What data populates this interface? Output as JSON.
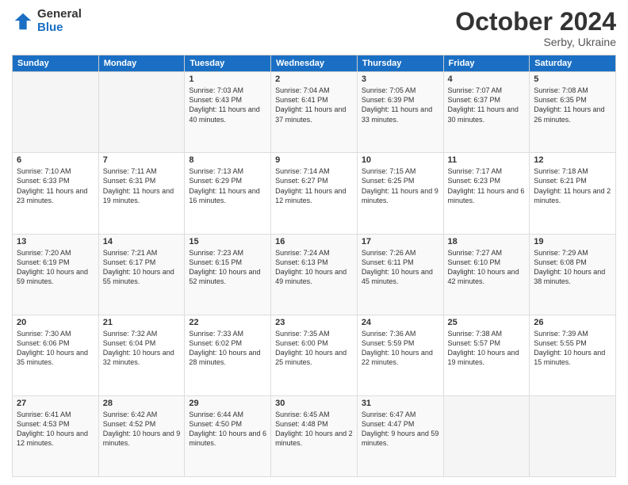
{
  "logo": {
    "general": "General",
    "blue": "Blue"
  },
  "header": {
    "month_year": "October 2024",
    "location": "Serby, Ukraine"
  },
  "weekdays": [
    "Sunday",
    "Monday",
    "Tuesday",
    "Wednesday",
    "Thursday",
    "Friday",
    "Saturday"
  ],
  "weeks": [
    [
      {
        "day": "",
        "content": ""
      },
      {
        "day": "",
        "content": ""
      },
      {
        "day": "1",
        "content": "Sunrise: 7:03 AM\nSunset: 6:43 PM\nDaylight: 11 hours and 40 minutes."
      },
      {
        "day": "2",
        "content": "Sunrise: 7:04 AM\nSunset: 6:41 PM\nDaylight: 11 hours and 37 minutes."
      },
      {
        "day": "3",
        "content": "Sunrise: 7:05 AM\nSunset: 6:39 PM\nDaylight: 11 hours and 33 minutes."
      },
      {
        "day": "4",
        "content": "Sunrise: 7:07 AM\nSunset: 6:37 PM\nDaylight: 11 hours and 30 minutes."
      },
      {
        "day": "5",
        "content": "Sunrise: 7:08 AM\nSunset: 6:35 PM\nDaylight: 11 hours and 26 minutes."
      }
    ],
    [
      {
        "day": "6",
        "content": "Sunrise: 7:10 AM\nSunset: 6:33 PM\nDaylight: 11 hours and 23 minutes."
      },
      {
        "day": "7",
        "content": "Sunrise: 7:11 AM\nSunset: 6:31 PM\nDaylight: 11 hours and 19 minutes."
      },
      {
        "day": "8",
        "content": "Sunrise: 7:13 AM\nSunset: 6:29 PM\nDaylight: 11 hours and 16 minutes."
      },
      {
        "day": "9",
        "content": "Sunrise: 7:14 AM\nSunset: 6:27 PM\nDaylight: 11 hours and 12 minutes."
      },
      {
        "day": "10",
        "content": "Sunrise: 7:15 AM\nSunset: 6:25 PM\nDaylight: 11 hours and 9 minutes."
      },
      {
        "day": "11",
        "content": "Sunrise: 7:17 AM\nSunset: 6:23 PM\nDaylight: 11 hours and 6 minutes."
      },
      {
        "day": "12",
        "content": "Sunrise: 7:18 AM\nSunset: 6:21 PM\nDaylight: 11 hours and 2 minutes."
      }
    ],
    [
      {
        "day": "13",
        "content": "Sunrise: 7:20 AM\nSunset: 6:19 PM\nDaylight: 10 hours and 59 minutes."
      },
      {
        "day": "14",
        "content": "Sunrise: 7:21 AM\nSunset: 6:17 PM\nDaylight: 10 hours and 55 minutes."
      },
      {
        "day": "15",
        "content": "Sunrise: 7:23 AM\nSunset: 6:15 PM\nDaylight: 10 hours and 52 minutes."
      },
      {
        "day": "16",
        "content": "Sunrise: 7:24 AM\nSunset: 6:13 PM\nDaylight: 10 hours and 49 minutes."
      },
      {
        "day": "17",
        "content": "Sunrise: 7:26 AM\nSunset: 6:11 PM\nDaylight: 10 hours and 45 minutes."
      },
      {
        "day": "18",
        "content": "Sunrise: 7:27 AM\nSunset: 6:10 PM\nDaylight: 10 hours and 42 minutes."
      },
      {
        "day": "19",
        "content": "Sunrise: 7:29 AM\nSunset: 6:08 PM\nDaylight: 10 hours and 38 minutes."
      }
    ],
    [
      {
        "day": "20",
        "content": "Sunrise: 7:30 AM\nSunset: 6:06 PM\nDaylight: 10 hours and 35 minutes."
      },
      {
        "day": "21",
        "content": "Sunrise: 7:32 AM\nSunset: 6:04 PM\nDaylight: 10 hours and 32 minutes."
      },
      {
        "day": "22",
        "content": "Sunrise: 7:33 AM\nSunset: 6:02 PM\nDaylight: 10 hours and 28 minutes."
      },
      {
        "day": "23",
        "content": "Sunrise: 7:35 AM\nSunset: 6:00 PM\nDaylight: 10 hours and 25 minutes."
      },
      {
        "day": "24",
        "content": "Sunrise: 7:36 AM\nSunset: 5:59 PM\nDaylight: 10 hours and 22 minutes."
      },
      {
        "day": "25",
        "content": "Sunrise: 7:38 AM\nSunset: 5:57 PM\nDaylight: 10 hours and 19 minutes."
      },
      {
        "day": "26",
        "content": "Sunrise: 7:39 AM\nSunset: 5:55 PM\nDaylight: 10 hours and 15 minutes."
      }
    ],
    [
      {
        "day": "27",
        "content": "Sunrise: 6:41 AM\nSunset: 4:53 PM\nDaylight: 10 hours and 12 minutes."
      },
      {
        "day": "28",
        "content": "Sunrise: 6:42 AM\nSunset: 4:52 PM\nDaylight: 10 hours and 9 minutes."
      },
      {
        "day": "29",
        "content": "Sunrise: 6:44 AM\nSunset: 4:50 PM\nDaylight: 10 hours and 6 minutes."
      },
      {
        "day": "30",
        "content": "Sunrise: 6:45 AM\nSunset: 4:48 PM\nDaylight: 10 hours and 2 minutes."
      },
      {
        "day": "31",
        "content": "Sunrise: 6:47 AM\nSunset: 4:47 PM\nDaylight: 9 hours and 59 minutes."
      },
      {
        "day": "",
        "content": ""
      },
      {
        "day": "",
        "content": ""
      }
    ]
  ]
}
